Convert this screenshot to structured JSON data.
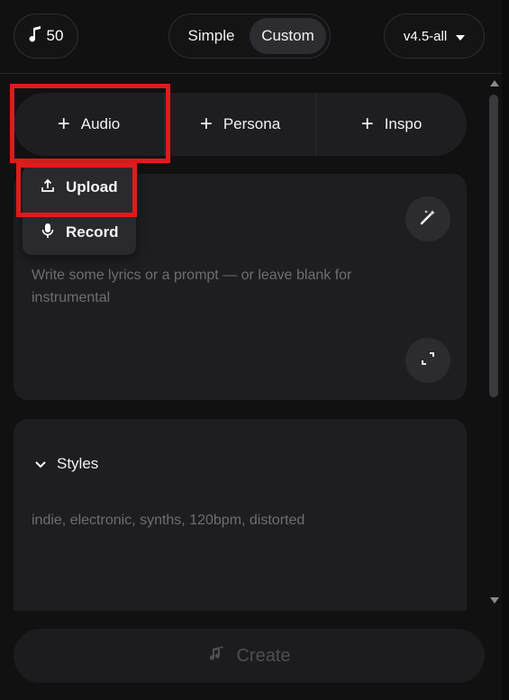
{
  "header": {
    "credits": "50",
    "modes": [
      "Simple",
      "Custom"
    ],
    "active_mode": "Custom",
    "version": "v4.5-all"
  },
  "add_row": {
    "audio": "Audio",
    "persona": "Persona",
    "inspo": "Inspo"
  },
  "audio_menu": {
    "upload": "Upload",
    "record": "Record"
  },
  "lyrics": {
    "placeholder": "Write some lyrics or a prompt — or leave blank for instrumental"
  },
  "styles": {
    "label": "Styles",
    "placeholder": "indie, electronic, synths, 120bpm, distorted"
  },
  "footer": {
    "create": "Create"
  },
  "colors": {
    "background": "#111112",
    "card": "#1e1e21",
    "highlight": "#e01b1b"
  },
  "icons": [
    "music-note-icon",
    "caret-down-icon",
    "plus-icon",
    "upload-icon",
    "microphone-icon",
    "magic-wand-icon",
    "expand-icon",
    "chevron-down-icon",
    "create-music-icon"
  ]
}
